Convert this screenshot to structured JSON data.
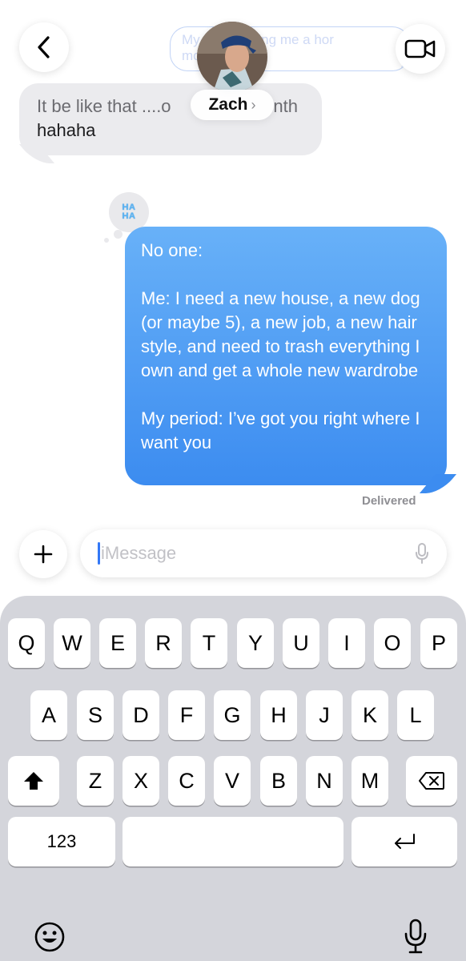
{
  "header": {
    "contact_name": "Zach",
    "previous_blue_message_fragment_1": "My        also making me a hor",
    "previous_blue_message_fragment_2": "mo        now lol"
  },
  "messages": [
    {
      "from": "contact",
      "line1": "It be like that ....o",
      "line1_end": "nth",
      "line2": "hahaha"
    },
    {
      "from": "me",
      "tapback": "HA HA",
      "paragraphs": [
        "No one:",
        "Me: I need a new house, a new dog (or maybe 5), a new job, a new hair style, and need to trash everything I own and get a whole new wardrobe",
        "My period: I’ve got you right where I want you"
      ],
      "status": "Delivered"
    }
  ],
  "compose": {
    "placeholder": "iMessage"
  },
  "keyboard": {
    "row1": [
      "Q",
      "W",
      "E",
      "R",
      "T",
      "Y",
      "U",
      "I",
      "O",
      "P"
    ],
    "row2": [
      "A",
      "S",
      "D",
      "F",
      "G",
      "H",
      "J",
      "K",
      "L"
    ],
    "row3": [
      "Z",
      "X",
      "C",
      "V",
      "B",
      "N",
      "M"
    ],
    "numbers_key": "123"
  },
  "colors": {
    "accent": "#3478f6",
    "bubble_blue": "#4a96f2",
    "bubble_gray": "#ebebee"
  }
}
